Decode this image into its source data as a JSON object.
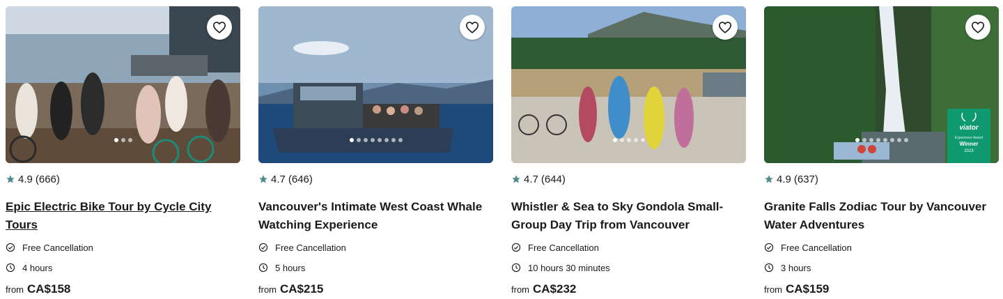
{
  "colors": {
    "star": "#4f8a8b",
    "text": "#1a1a1a",
    "badge": "#0e9a6e"
  },
  "icons": {
    "wishlist": "heart-outline-icon",
    "rating": "star-icon",
    "cancellation": "check-circle-icon",
    "duration": "clock-icon"
  },
  "cards": [
    {
      "rating": "4.9",
      "reviews": "(666)",
      "title": "Epic Electric Bike Tour by Cycle City Tours",
      "cancellation": "Free Cancellation",
      "duration": "4 hours",
      "from_label": "from",
      "price": "CA$158"
    },
    {
      "rating": "4.7",
      "reviews": "(646)",
      "title": "Vancouver's Intimate West Coast Whale Watching Experience",
      "cancellation": "Free Cancellation",
      "duration": "5 hours",
      "from_label": "from",
      "price": "CA$215"
    },
    {
      "rating": "4.7",
      "reviews": "(644)",
      "title": "Whistler & Sea to Sky Gondola Small-Group Day Trip from Vancouver",
      "cancellation": "Free Cancellation",
      "duration": "10 hours 30 minutes",
      "from_label": "from",
      "price": "CA$232"
    },
    {
      "rating": "4.9",
      "reviews": "(637)",
      "title": "Granite Falls Zodiac Tour by Vancouver Water Adventures",
      "cancellation": "Free Cancellation",
      "duration": "3 hours",
      "from_label": "from",
      "price": "CA$159",
      "badge": {
        "brand": "viator",
        "award": "Experience Award",
        "title": "Winner",
        "year": "2023"
      }
    }
  ]
}
